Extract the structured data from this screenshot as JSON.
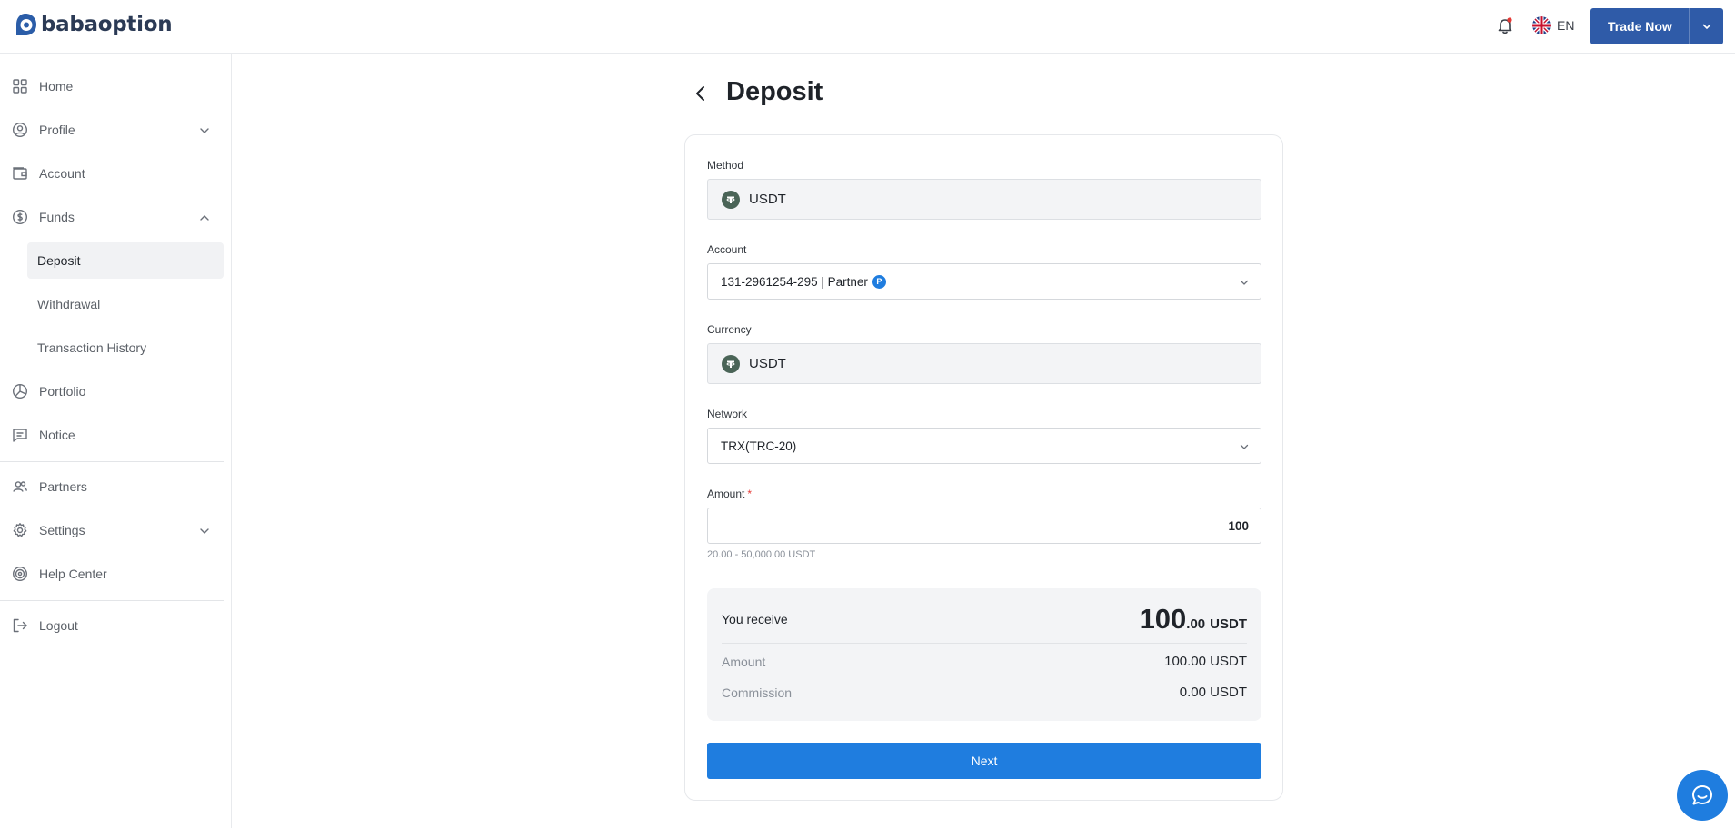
{
  "header": {
    "brand": "babaoption",
    "language": "EN",
    "trade_button": "Trade Now"
  },
  "sidebar": {
    "items": [
      {
        "label": "Home",
        "icon": "grid-icon"
      },
      {
        "label": "Profile",
        "icon": "user-circle-icon"
      },
      {
        "label": "Account",
        "icon": "wallet-icon"
      },
      {
        "label": "Funds",
        "icon": "dollar-circle-icon"
      },
      {
        "label": "Portfolio",
        "icon": "pie-chart-icon"
      },
      {
        "label": "Notice",
        "icon": "message-icon"
      },
      {
        "label": "Partners",
        "icon": "users-icon"
      },
      {
        "label": "Settings",
        "icon": "gear-icon"
      },
      {
        "label": "Help Center",
        "icon": "lifebuoy-icon"
      },
      {
        "label": "Logout",
        "icon": "logout-icon"
      }
    ],
    "funds_sub": [
      {
        "label": "Deposit",
        "active": true
      },
      {
        "label": "Withdrawal",
        "active": false
      },
      {
        "label": "Transaction History",
        "active": false
      }
    ]
  },
  "page": {
    "title": "Deposit"
  },
  "form": {
    "method_label": "Method",
    "method_value": "USDT",
    "account_label": "Account",
    "account_value": "131-2961254-295 | Partner",
    "account_badge": "P",
    "currency_label": "Currency",
    "currency_value": "USDT",
    "network_label": "Network",
    "network_value": "TRX(TRC-20)",
    "amount_label": "Amount",
    "amount_required": "*",
    "amount_value": "100",
    "amount_hint": "20.00 - 50,000.00 USDT"
  },
  "summary": {
    "receive_label": "You receive",
    "receive_int": "100",
    "receive_dec": ".00",
    "receive_currency": "USDT",
    "amount_label": "Amount",
    "amount_value": "100.00 USDT",
    "commission_label": "Commission",
    "commission_value": "0.00 USDT"
  },
  "actions": {
    "next_label": "Next"
  },
  "colors": {
    "primary": "#1f7ddf",
    "trade_button": "#2f5ba8",
    "tether": "#4a6457"
  }
}
